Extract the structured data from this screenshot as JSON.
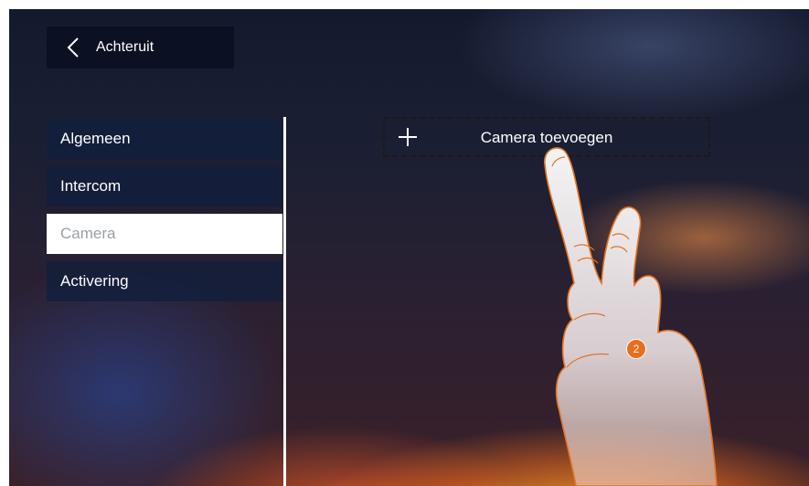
{
  "header": {
    "back_label": "Achteruit"
  },
  "menu": {
    "items": [
      {
        "label": "Algemeen"
      },
      {
        "label": "Intercom"
      },
      {
        "label": "Camera"
      },
      {
        "label": "Activering"
      }
    ],
    "active_item": "Camera"
  },
  "content": {
    "add_camera_label": "Camera toevoegen"
  },
  "overlay": {
    "step_number": "2"
  },
  "colors": {
    "menu_background": "#121e3c",
    "active_background": "#ffffff",
    "active_text": "#9aa0a8",
    "accent": "#e96e1c",
    "hand_outline": "#e27424"
  },
  "icons": {
    "back": "chevron-left-icon",
    "add": "plus-icon",
    "gesture": "pointing-hand-icon"
  }
}
